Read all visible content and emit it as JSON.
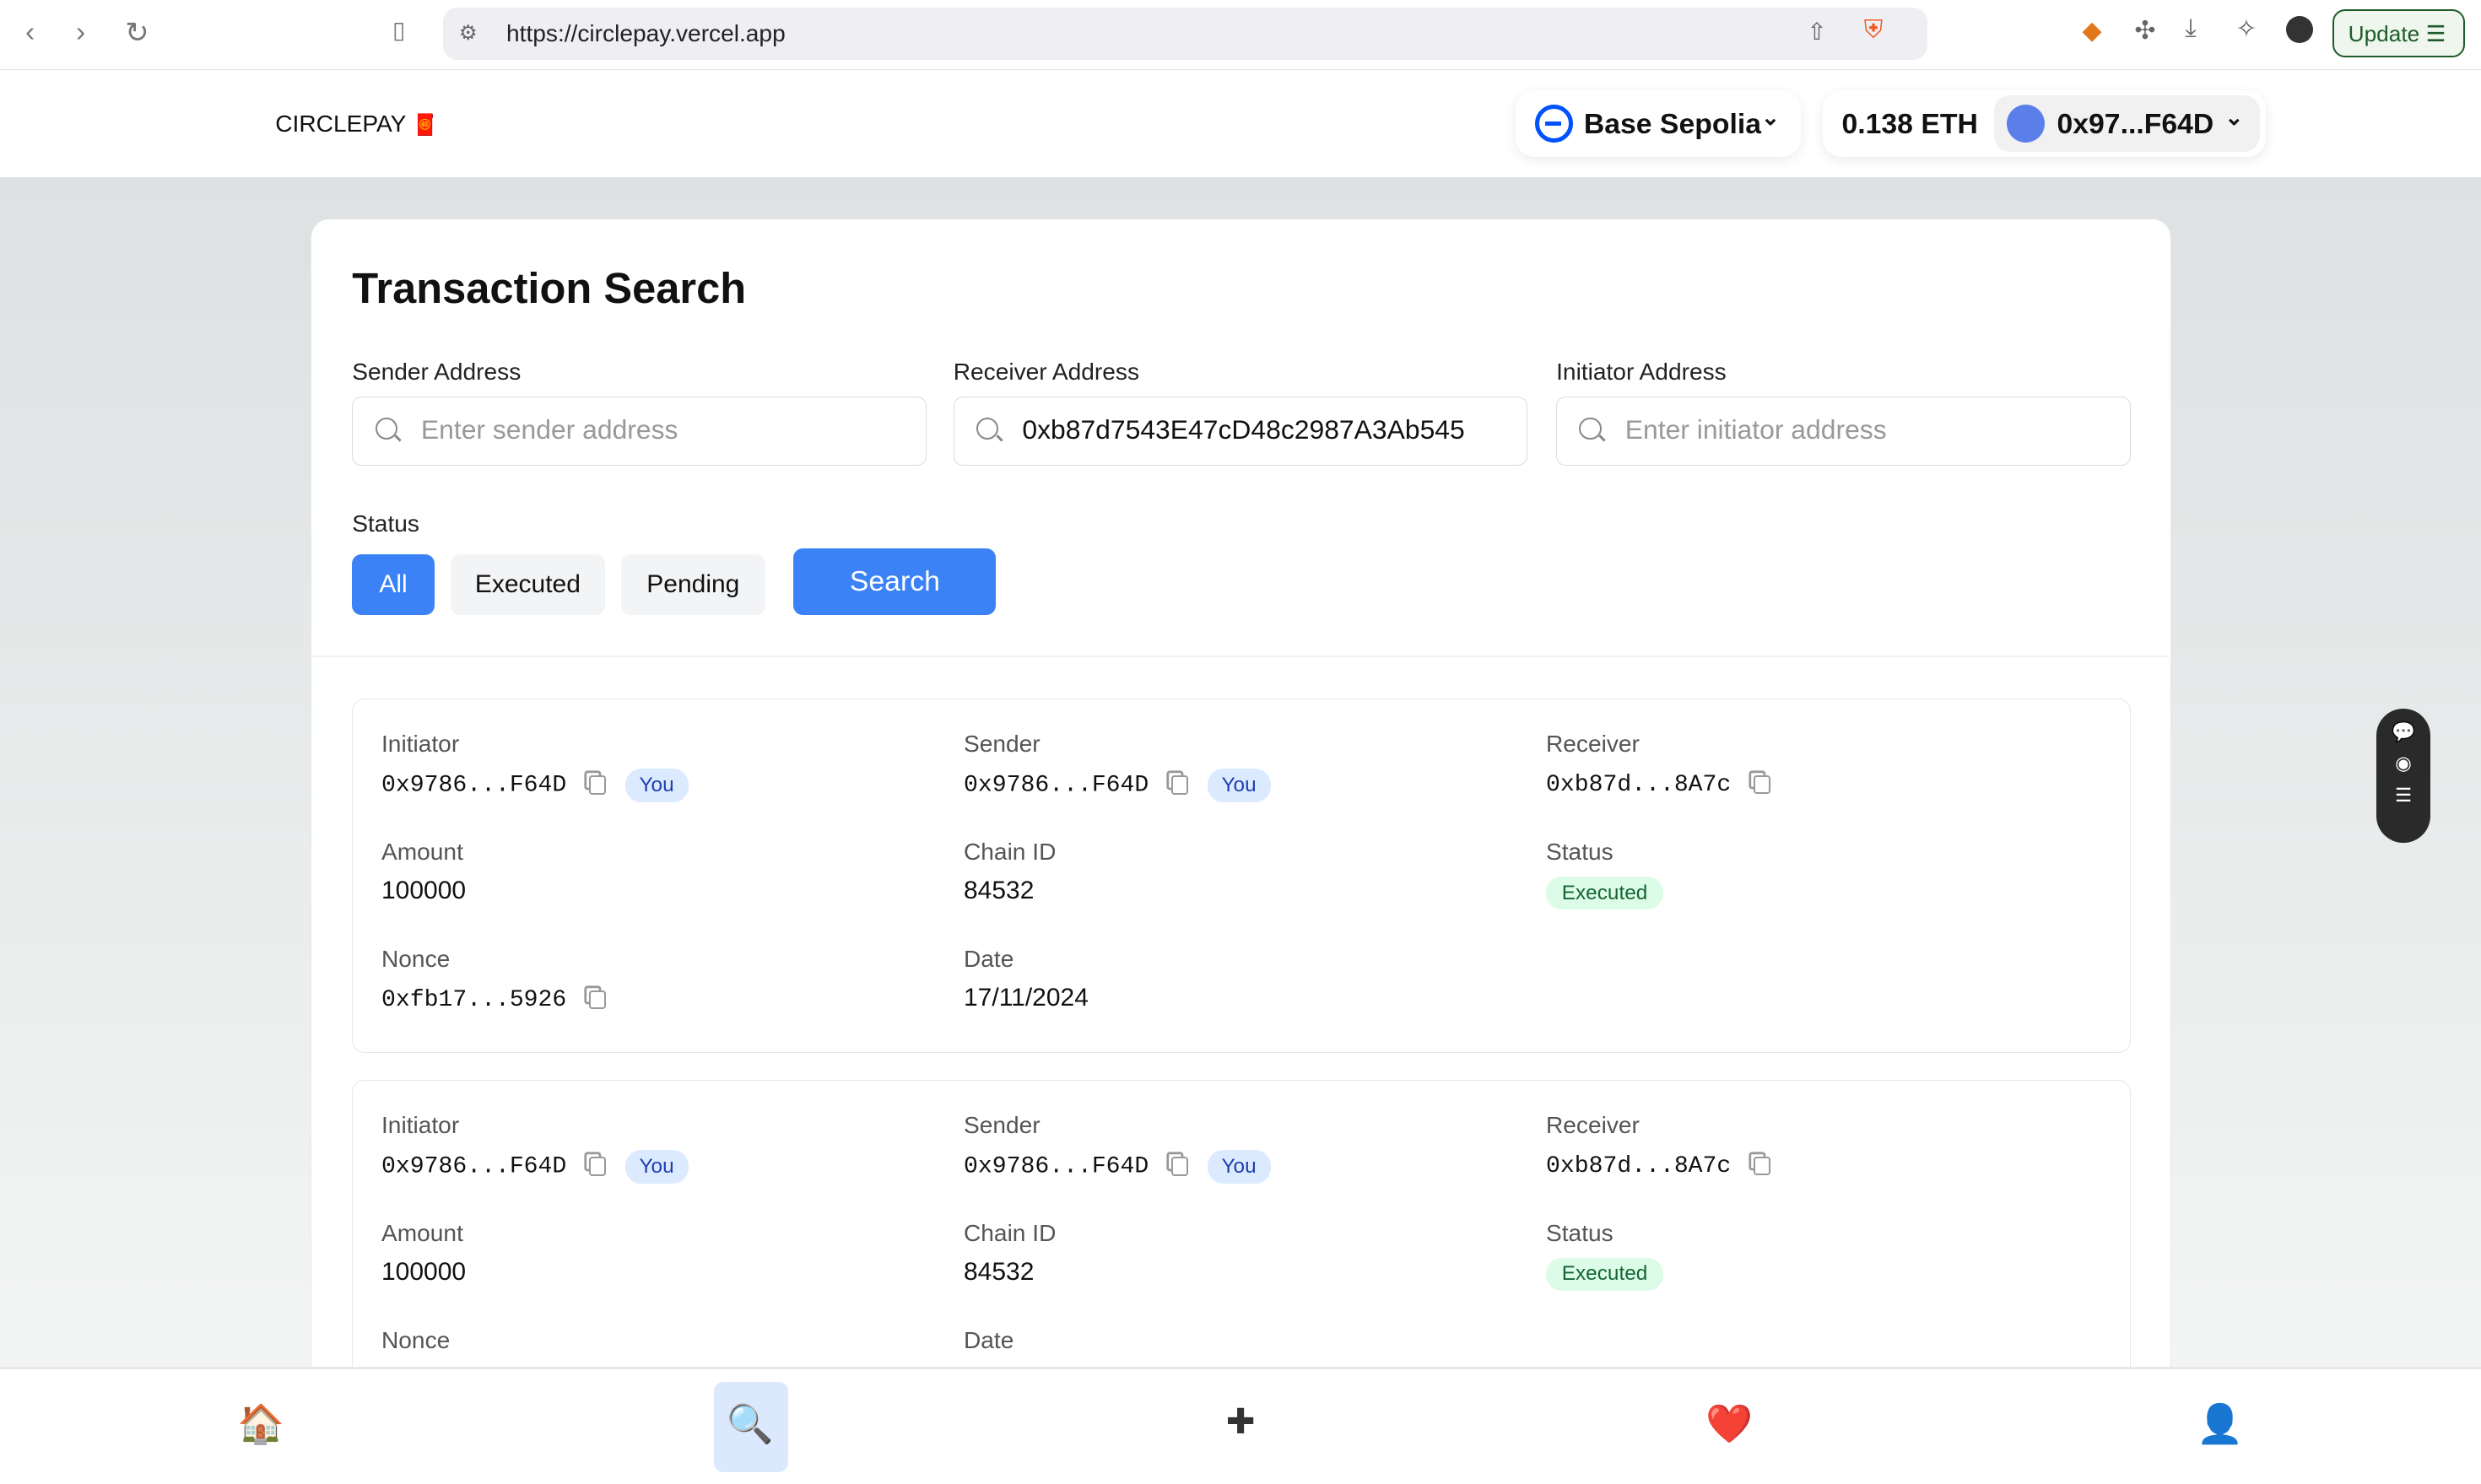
{
  "browser": {
    "url": "https://circlepay.vercel.app",
    "update_label": "Update"
  },
  "header": {
    "logo": "CIRCLEPAY",
    "network": "Base Sepolia",
    "balance": "0.138 ETH",
    "account": "0x97...F64D"
  },
  "search": {
    "title": "Transaction Search",
    "sender": {
      "label": "Sender Address",
      "placeholder": "Enter sender address",
      "value": ""
    },
    "receiver": {
      "label": "Receiver Address",
      "value": "0xb87d7543E47cD48c2987A3Ab545"
    },
    "initiator": {
      "label": "Initiator Address",
      "placeholder": "Enter initiator address",
      "value": ""
    },
    "status_label": "Status",
    "status_options": [
      "All",
      "Executed",
      "Pending"
    ],
    "selected_status": "All",
    "search_label": "Search"
  },
  "labels": {
    "initiator": "Initiator",
    "sender": "Sender",
    "receiver": "Receiver",
    "amount": "Amount",
    "chain": "Chain ID",
    "status": "Status",
    "nonce": "Nonce",
    "date": "Date",
    "you": "You"
  },
  "transactions": [
    {
      "initiator": "0x9786...F64D",
      "sender": "0x9786...F64D",
      "receiver": "0xb87d...8A7c",
      "amount": "100000",
      "chain_id": "84532",
      "status": "Executed",
      "nonce": "0xfb17...5926",
      "date": "17/11/2024"
    },
    {
      "initiator": "0x9786...F64D",
      "sender": "0x9786...F64D",
      "receiver": "0xb87d...8A7c",
      "amount": "100000",
      "chain_id": "84532",
      "status": "Executed"
    }
  ],
  "bottom_nav": [
    {
      "icon": "home-icon",
      "glyph": "🏠"
    },
    {
      "icon": "search-icon",
      "glyph": "🔍",
      "active": true
    },
    {
      "icon": "plus-icon",
      "glyph": "✚"
    },
    {
      "icon": "heart-icon",
      "glyph": "❤️"
    },
    {
      "icon": "profile-icon",
      "glyph": "👤"
    }
  ],
  "colors": {
    "accent": "#3b82f6",
    "executed_bg": "#dcfce7",
    "you_bg": "#dbeafe"
  }
}
